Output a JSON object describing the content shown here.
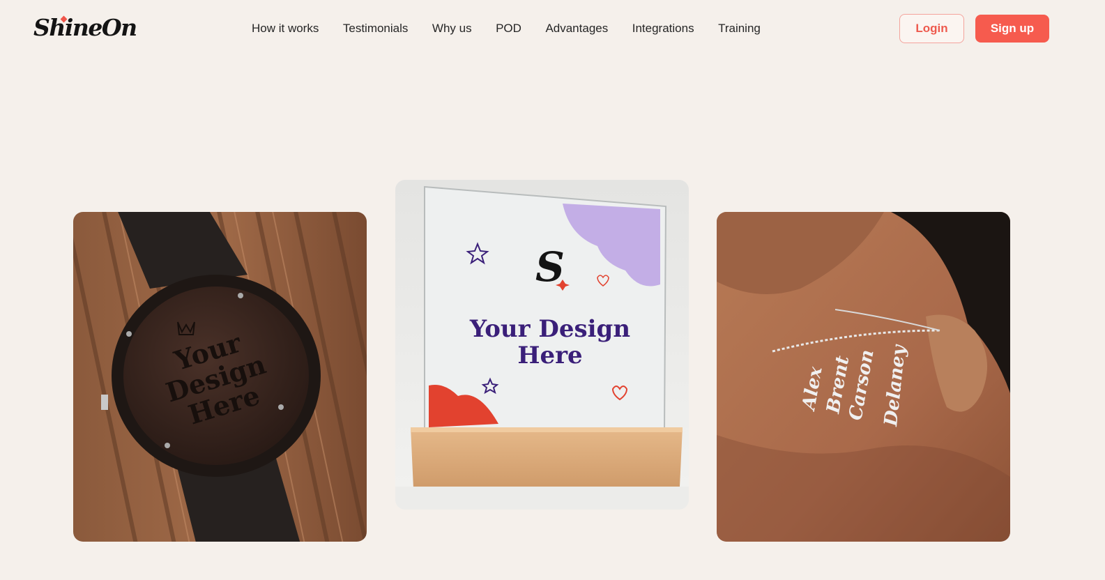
{
  "brand": {
    "logo_text": "ShineOn",
    "accent_color": "#f65b4e"
  },
  "nav": {
    "items": [
      {
        "label": "How it works"
      },
      {
        "label": "Testimonials"
      },
      {
        "label": "Why us"
      },
      {
        "label": "POD"
      },
      {
        "label": "Advantages"
      },
      {
        "label": "Integrations"
      },
      {
        "label": "Training"
      }
    ]
  },
  "auth": {
    "login_label": "Login",
    "signup_label": "Sign up"
  },
  "products": {
    "watch": {
      "engraving": [
        "Your",
        "Design",
        "Here"
      ]
    },
    "acrylic": {
      "logo_letter": "S",
      "line1": "Your Design",
      "line2": "Here"
    },
    "necklace": {
      "names": [
        "Alex",
        "Brent",
        "Carson",
        "Delaney"
      ]
    }
  }
}
